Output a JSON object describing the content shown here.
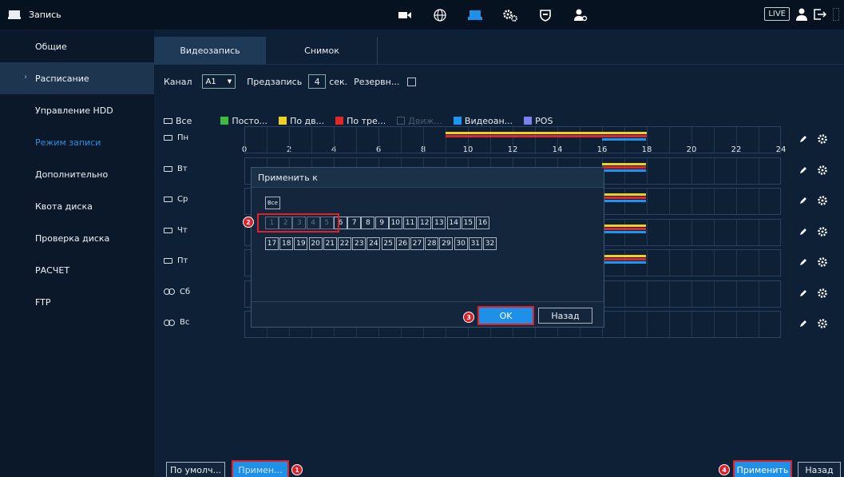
{
  "window": {
    "title": "Запись"
  },
  "topbar": {
    "icons": [
      "camera-icon",
      "globe-icon",
      "storage-icon",
      "settings-icon",
      "shield-icon",
      "account-icon"
    ],
    "live_label": "LIVE"
  },
  "sidebar": {
    "items": [
      {
        "label": "Общие"
      },
      {
        "label": "Расписание"
      },
      {
        "label": "Управление HDD"
      },
      {
        "label": "Режим записи"
      },
      {
        "label": "Дополнительно"
      },
      {
        "label": "Квота диска"
      },
      {
        "label": "Проверка диска"
      },
      {
        "label": "РАСЧЕТ"
      },
      {
        "label": "FTP"
      }
    ]
  },
  "tabs": [
    {
      "label": "Видеозапись"
    },
    {
      "label": "Снимок"
    }
  ],
  "controls": {
    "channel_label": "Канал",
    "channel_value": "A1",
    "prerecord_label": "Предзапись",
    "prerecord_value": "4",
    "prerecord_unit": "сек.",
    "backup_label": "Резервн..."
  },
  "legend": {
    "all_label": "Все",
    "items": [
      {
        "label": "Посто...",
        "color": "#3dbb3d",
        "dim": false
      },
      {
        "label": "По дв...",
        "color": "#f0d020",
        "dim": false
      },
      {
        "label": "По тре...",
        "color": "#e02828",
        "dim": false
      },
      {
        "label": "Движ...",
        "color": "",
        "dim": true
      },
      {
        "label": "Видеоан...",
        "color": "#1e96f0",
        "dim": false
      },
      {
        "label": "POS",
        "color": "#7b82f0",
        "dim": false
      }
    ]
  },
  "axis": {
    "ticks": [
      "0",
      "2",
      "4",
      "6",
      "8",
      "10",
      "12",
      "14",
      "16",
      "18",
      "20",
      "22",
      "24"
    ]
  },
  "days": [
    {
      "label": "Пн",
      "linked": false,
      "bars": [
        {
          "start": 9,
          "end": 18,
          "color": "#f0d020"
        },
        {
          "start": 9,
          "end": 18,
          "color": "#e02828"
        },
        {
          "start": 16,
          "end": 18,
          "color": "#1e96f0"
        }
      ]
    },
    {
      "label": "Вт",
      "linked": false,
      "bars": [
        {
          "start": 16,
          "end": 18,
          "color": "#f0d020"
        },
        {
          "start": 16,
          "end": 18,
          "color": "#e02828"
        },
        {
          "start": 16,
          "end": 18,
          "color": "#1e96f0"
        }
      ]
    },
    {
      "label": "Ср",
      "linked": false,
      "bars": [
        {
          "start": 16,
          "end": 18,
          "color": "#f0d020"
        },
        {
          "start": 16,
          "end": 18,
          "color": "#e02828"
        },
        {
          "start": 16,
          "end": 18,
          "color": "#1e96f0"
        }
      ]
    },
    {
      "label": "Чт",
      "linked": false,
      "bars": [
        {
          "start": 16,
          "end": 18,
          "color": "#f0d020"
        },
        {
          "start": 16,
          "end": 18,
          "color": "#e02828"
        },
        {
          "start": 16,
          "end": 18,
          "color": "#1e96f0"
        }
      ]
    },
    {
      "label": "Пт",
      "linked": false,
      "bars": [
        {
          "start": 16,
          "end": 18,
          "color": "#f0d020"
        },
        {
          "start": 16,
          "end": 18,
          "color": "#e02828"
        },
        {
          "start": 16,
          "end": 18,
          "color": "#1e96f0"
        }
      ]
    },
    {
      "label": "Сб",
      "linked": true,
      "bars": []
    },
    {
      "label": "Вс",
      "linked": true,
      "bars": []
    }
  ],
  "dialog": {
    "title": "Применить к",
    "all_label": "Все",
    "channels_row1": [
      "1",
      "2",
      "3",
      "4",
      "5",
      "6",
      "7",
      "8",
      "9",
      "10",
      "11",
      "12",
      "13",
      "14",
      "15",
      "16"
    ],
    "channels_row2": [
      "17",
      "18",
      "19",
      "20",
      "21",
      "22",
      "23",
      "24",
      "25",
      "26",
      "27",
      "28",
      "29",
      "30",
      "31",
      "32"
    ],
    "ok_label": "OK",
    "back_label": "Назад"
  },
  "bottom": {
    "default_label": "По умолч...",
    "copy_label": "Примен...",
    "apply_label": "Применить",
    "back_label": "Назад"
  },
  "markers": [
    "1",
    "2",
    "3",
    "4"
  ],
  "colors": {
    "accent": "#1e90e8",
    "highlight": "#e0202a"
  }
}
